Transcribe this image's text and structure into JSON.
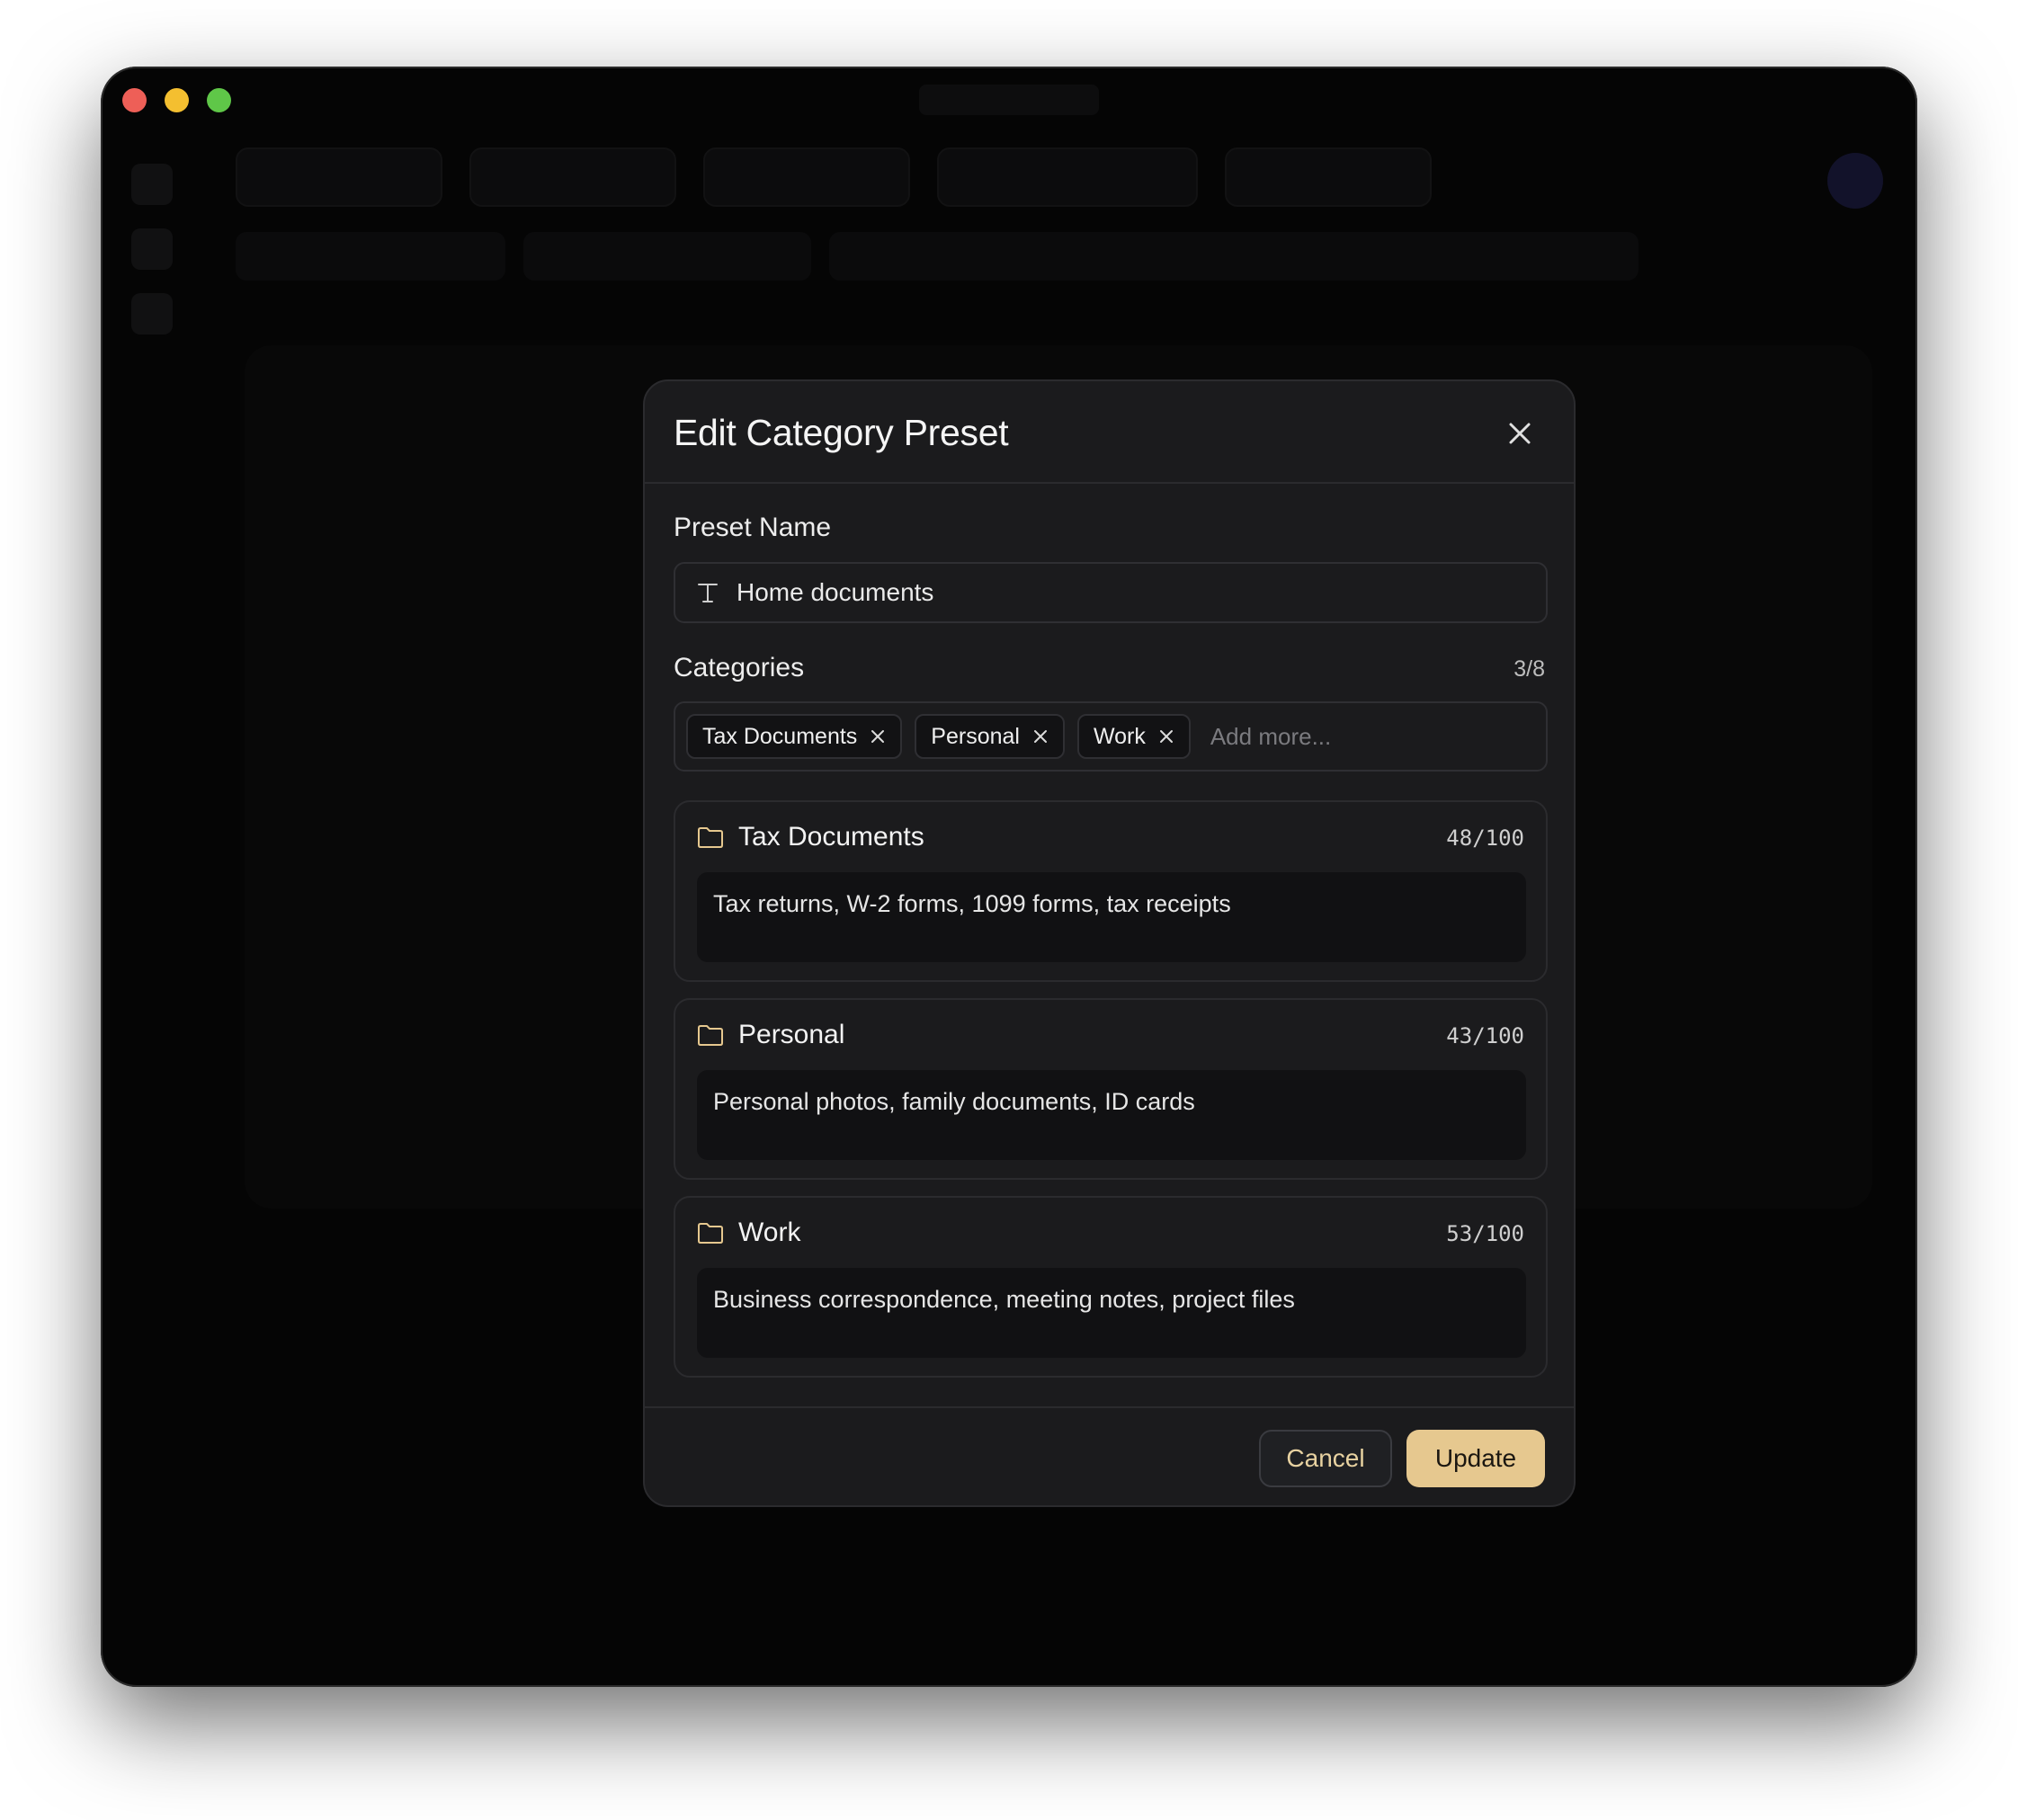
{
  "colors": {
    "accent": "#e6c88f",
    "modal_bg": "#1b1b1d",
    "window_bg": "#050505",
    "folder_icon": "#e6c88f"
  },
  "modal": {
    "title": "Edit Category Preset",
    "close_icon": "close-icon"
  },
  "preset_name": {
    "label": "Preset Name",
    "value": "Home documents",
    "icon": "text-type-icon"
  },
  "categories": {
    "label": "Categories",
    "count": "3/8",
    "add_placeholder": "Add more...",
    "tags": [
      {
        "label": "Tax Documents"
      },
      {
        "label": "Personal"
      },
      {
        "label": "Work"
      }
    ],
    "cards": [
      {
        "name": "Tax Documents",
        "count": "48/100",
        "description": "Tax returns, W-2 forms, 1099 forms, tax receipts"
      },
      {
        "name": "Personal",
        "count": "43/100",
        "description": "Personal photos, family documents, ID cards"
      },
      {
        "name": "Work",
        "count": "53/100",
        "description": "Business correspondence, meeting notes, project files"
      }
    ]
  },
  "footer": {
    "cancel_label": "Cancel",
    "update_label": "Update"
  }
}
